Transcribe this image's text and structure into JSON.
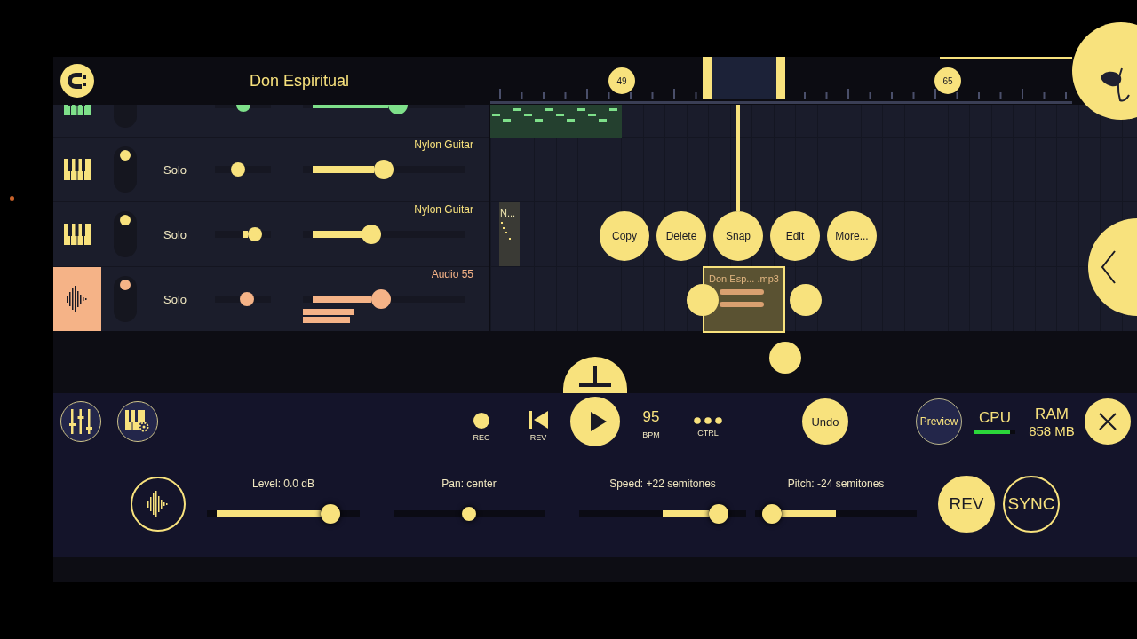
{
  "title": "Don Espiritual",
  "ruler": {
    "markers": [
      {
        "label": "49"
      },
      {
        "label": "65"
      }
    ]
  },
  "tracks": [
    {
      "kind": "pattern",
      "color": "#7ee08a",
      "selected": false,
      "pan": {
        "level": 0.5
      },
      "volume": {
        "level": 0.6
      },
      "clip": {
        "kind": "pattern",
        "selected": false
      }
    },
    {
      "kind": "pattern",
      "name": "Nylon Guitar",
      "color": "#f8e27d",
      "selected": false,
      "on": true,
      "solo_label": "Solo",
      "pan": {
        "level": 0.38
      },
      "volume": {
        "level": 0.5
      }
    },
    {
      "kind": "pattern",
      "name": "Nylon Guitar",
      "color": "#f8e27d",
      "selected": false,
      "on": true,
      "solo_label": "Solo",
      "pan": {
        "level": 0.78
      },
      "volume": {
        "level": 0.41
      },
      "clip": {
        "kind": "pattern",
        "label": "N...",
        "selected": false
      }
    },
    {
      "kind": "audio",
      "name": "Audio 55",
      "color": "#f5b387",
      "selected": true,
      "on": true,
      "solo_label": "Solo",
      "pan": {
        "level": 0.6
      },
      "volume": {
        "level": 0.48
      },
      "clip": {
        "kind": "audio",
        "label": "Don Esp... .mp3",
        "selected": true
      }
    }
  ],
  "context_menu": [
    "Copy",
    "Delete",
    "Snap",
    "Edit",
    "More..."
  ],
  "transport": {
    "rec": "REC",
    "rev": "REV",
    "bpm": "95",
    "bpm_label": "BPM",
    "ctrl": "CTRL",
    "undo": "Undo",
    "preview": "Preview",
    "cpu": {
      "label": "CPU",
      "level": 0.88
    },
    "ram": {
      "label": "RAM",
      "value": "858 MB"
    }
  },
  "audio_controls": {
    "sliders": [
      {
        "label": "Level: 0.0 dB",
        "kind": "unipolar",
        "level": 0.85
      },
      {
        "label": "Pan: center",
        "kind": "bipolar",
        "level": 0.5
      },
      {
        "label": "Speed: +22 semitones",
        "kind": "bipolar",
        "level": 0.88
      },
      {
        "label": "Pitch: -24 semitones",
        "kind": "bipolar",
        "level": 0.05
      }
    ],
    "buttons": [
      {
        "label": "REV",
        "on": true
      },
      {
        "label": "SYNC",
        "on": false
      }
    ]
  }
}
